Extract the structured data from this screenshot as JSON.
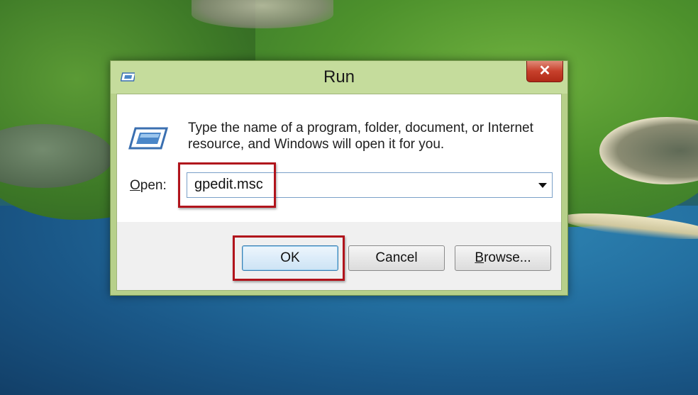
{
  "window": {
    "title": "Run",
    "close_label": "✕"
  },
  "dialog": {
    "description": "Type the name of a program, folder, document, or Internet resource, and Windows will open it for you.",
    "open_label_accesskey": "O",
    "open_label_rest": "pen:",
    "open_value": "gpedit.msc"
  },
  "buttons": {
    "ok": "OK",
    "cancel": "Cancel",
    "browse_accesskey": "B",
    "browse_rest": "rowse..."
  },
  "icons": {
    "title": "run-icon",
    "dialog": "run-icon",
    "dropdown": "triangle-down-icon",
    "close": "close-icon"
  },
  "colors": {
    "highlight": "#b1141c",
    "titlebar": "#c5dc9c",
    "close_button": "#c7402b"
  }
}
